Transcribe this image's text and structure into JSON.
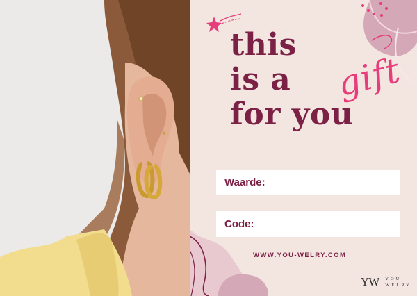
{
  "headline": {
    "line1": "this",
    "line2": "is a",
    "line3": "for you",
    "accent": "gift"
  },
  "fields": [
    {
      "label": "Waarde:",
      "value": ""
    },
    {
      "label": "Code:",
      "value": ""
    }
  ],
  "website": "WWW.YOU-WELRY.COM",
  "brand": {
    "monogram": "YW",
    "word1": "YOU",
    "word2": "WELRY"
  },
  "colors": {
    "background": "#f3e6e1",
    "primary": "#7b2146",
    "accent": "#e73d7b",
    "blob": "#d4a8b6"
  },
  "icons": [
    "shooting-star-icon"
  ]
}
